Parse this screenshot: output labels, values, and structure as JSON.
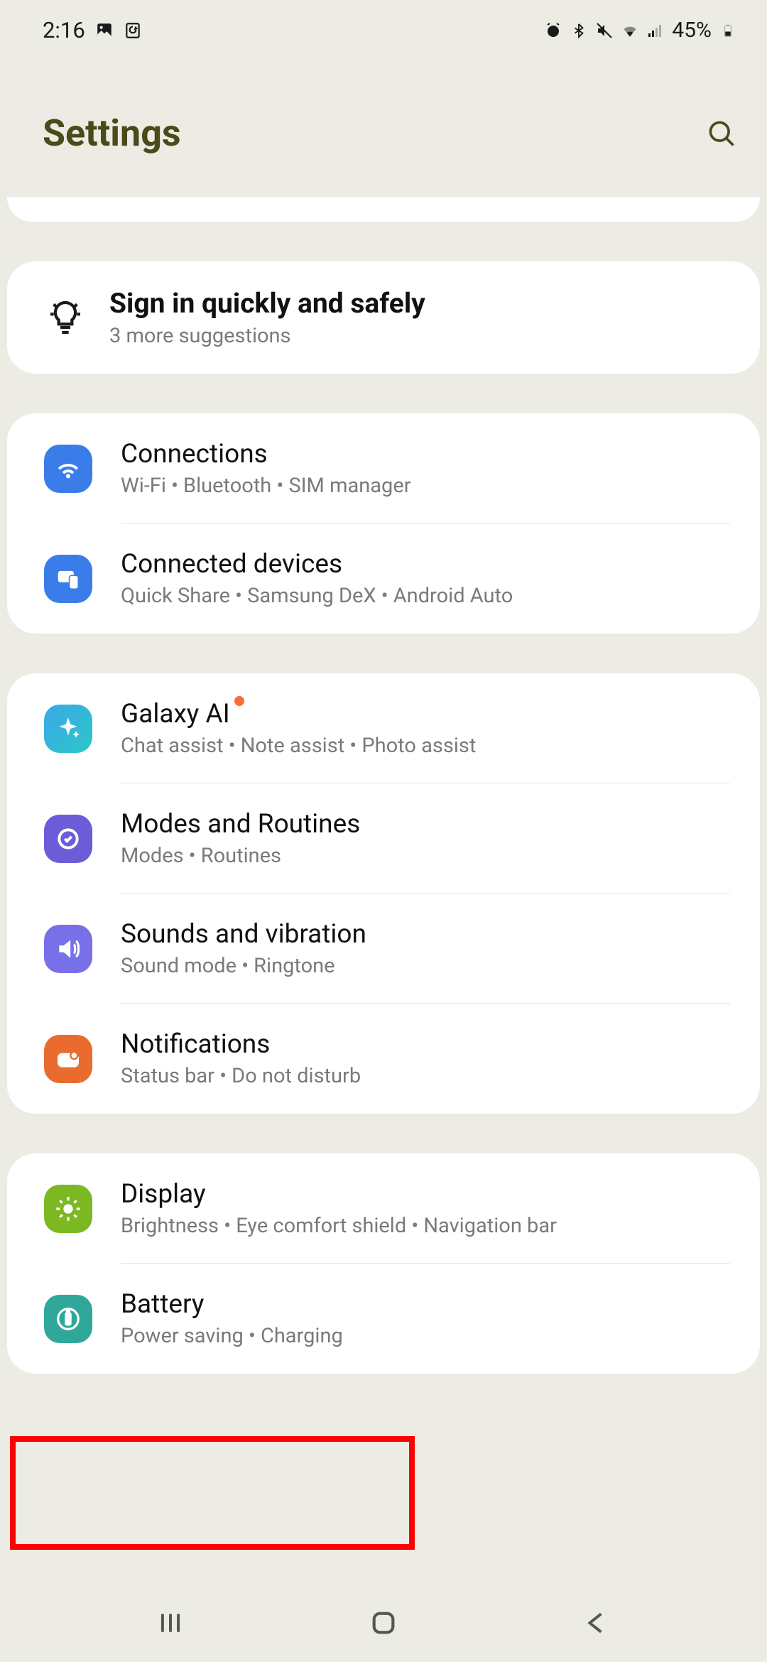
{
  "status_bar": {
    "time": "2:16",
    "battery_text": "45%"
  },
  "header": {
    "title": "Settings"
  },
  "suggestion": {
    "title": "Sign in quickly and safely",
    "subtitle": "3 more suggestions"
  },
  "groups": [
    {
      "items": [
        {
          "id": "connections",
          "title": "Connections",
          "subtitle": "Wi-Fi  •  Bluetooth  •  SIM manager",
          "icon_color": "#3b7de8",
          "has_badge": false
        },
        {
          "id": "connected-devices",
          "title": "Connected devices",
          "subtitle": "Quick Share  •  Samsung DeX  •  Android Auto",
          "icon_color": "#3b7de8",
          "has_badge": false
        }
      ]
    },
    {
      "items": [
        {
          "id": "galaxy-ai",
          "title": "Galaxy AI",
          "subtitle": "Chat assist  •  Note assist  •  Photo assist",
          "icon_color": "#2ba7d8",
          "has_badge": true
        },
        {
          "id": "modes-routines",
          "title": "Modes and Routines",
          "subtitle": "Modes  •  Routines",
          "icon_color": "#6b5cd8",
          "has_badge": false
        },
        {
          "id": "sounds-vibration",
          "title": "Sounds and vibration",
          "subtitle": "Sound mode  •  Ringtone",
          "icon_color": "#7870e8",
          "has_badge": false
        },
        {
          "id": "notifications",
          "title": "Notifications",
          "subtitle": "Status bar  •  Do not disturb",
          "icon_color": "#ea6b2e",
          "has_badge": false
        }
      ]
    },
    {
      "items": [
        {
          "id": "display",
          "title": "Display",
          "subtitle": "Brightness  •  Eye comfort shield  •  Navigation bar",
          "icon_color": "#7bb822",
          "has_badge": false
        },
        {
          "id": "battery",
          "title": "Battery",
          "subtitle": "Power saving  •  Charging",
          "icon_color": "#2fa89a",
          "has_badge": false
        }
      ]
    }
  ],
  "highlight": {
    "target_id": "battery"
  }
}
